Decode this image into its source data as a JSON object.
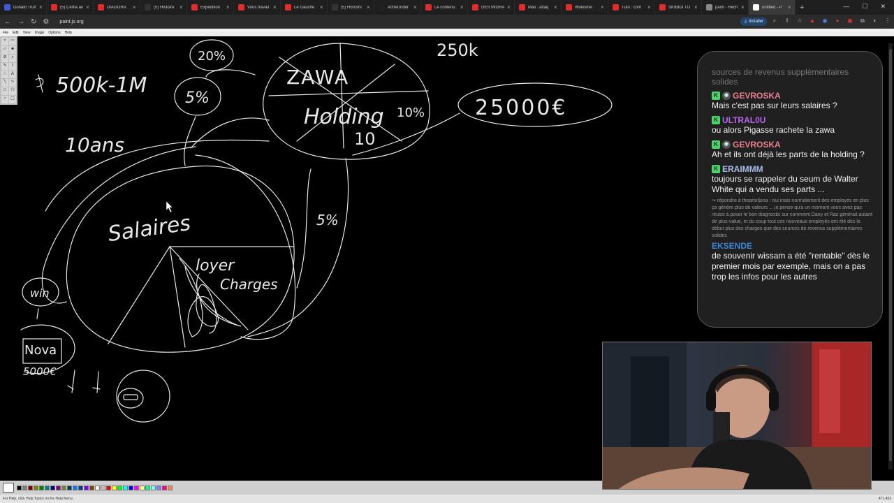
{
  "browser": {
    "tabs": [
      {
        "label": "Donald Trump",
        "color": "#3b5bd9"
      },
      {
        "label": "(5) Cerfia au",
        "color": "#e22b2b"
      },
      {
        "label": "DIAGORA",
        "color": "#e22b2b"
      },
      {
        "label": "(5) Histoire",
        "color": "#333333"
      },
      {
        "label": "Expédition",
        "color": "#e22b2b"
      },
      {
        "label": "Vous travail",
        "color": "#e22b2b"
      },
      {
        "label": "Le Gauche",
        "color": "#e22b2b"
      },
      {
        "label": "(5) Horoshi",
        "color": "#333333"
      },
      {
        "label": "AcheUnder",
        "color": "#222222"
      },
      {
        "label": "Le contenu",
        "color": "#e22b2b"
      },
      {
        "label": "DES MIGRA",
        "color": "#e22b2b"
      },
      {
        "label": "Mali : attaq",
        "color": "#e22b2b"
      },
      {
        "label": "Wokisme :",
        "color": "#e22b2b"
      },
      {
        "label": "Tuto : com",
        "color": "#e22b2b"
      },
      {
        "label": "SKIBIDI TO",
        "color": "#e22b2b"
      },
      {
        "label": "paint - Rech",
        "color": "#888888"
      },
      {
        "label": "untitled - P",
        "color": "#ffffff"
      }
    ],
    "url": "paint.js.org",
    "install_label": "Installer"
  },
  "paint": {
    "menu": [
      "File",
      "Edit",
      "View",
      "Image",
      "Options",
      "Help"
    ],
    "status_left": "For Help, click Help Topics on the Help Menu.",
    "status_right": "471,492",
    "palette": [
      "#000000",
      "#808080",
      "#800000",
      "#808000",
      "#008000",
      "#008080",
      "#000080",
      "#800080",
      "#808040",
      "#004040",
      "#0080ff",
      "#004080",
      "#8000ff",
      "#804000",
      "#ffffff",
      "#c0c0c0",
      "#ff0000",
      "#ffff00",
      "#00ff00",
      "#00ffff",
      "#0000ff",
      "#ff00ff",
      "#ffff80",
      "#00ff80",
      "#80ffff",
      "#8080ff",
      "#ff0080",
      "#ff8040"
    ],
    "drawing_text": {
      "t500k": "500k-1M",
      "t20": "20%",
      "tpct1": "5%",
      "t10ans": "10ans",
      "t250k": "250k",
      "t25000": "25000€",
      "tzawa": "ZAWA",
      "tholding": "Holding",
      "t10a": "10%",
      "t10b": "10",
      "tsalaires": "Salaires",
      "tloyer": "loyer",
      "tcharges": "Charges",
      "tpct2": "5%",
      "twin": "win",
      "tnova": "Nova",
      "tnova2": "5000€"
    }
  },
  "chat": {
    "fade_text": "sources de revenus supplémentaires solides",
    "messages": [
      {
        "user": "GEVROSKA",
        "color": "#e8808e",
        "text": "Mais c'est pas sur leurs salaires ?",
        "second_badge": true
      },
      {
        "user": "ULTRAL0U",
        "color": "#b266e6",
        "text": "ou alors Pigasse rachete la zawa",
        "second_badge": false
      },
      {
        "user": "GEVROSKA",
        "color": "#e8808e",
        "text": "Ah et ils ont déjà les parts de la holding ?",
        "second_badge": true
      },
      {
        "user": "ERAIMMM",
        "color": "#a6b8e6",
        "text": "toujours se rappeler du seum de Walter White qui a vendu ses parts ...",
        "second_badge": false
      }
    ],
    "reply": "↪ répondre à theartofjona : oui mais normalement des employés en plus ça génère plus de valeurs ... je pense qu'a un moment vous avez pas réussi à poser le bon diagnostic sur comment Dany et Raz générait autant de plus-value, et du coup tout ces nouveaux employés ont été dès le début plus des charges que des sources de revenus supplémentaires solides",
    "last": {
      "user": "EKSENDE",
      "color": "#3a87d6",
      "text": "de souvenir wissam a été \"rentable\" dès le premier mois par exemple, mais on a pas trop les infos pour les autres"
    }
  }
}
